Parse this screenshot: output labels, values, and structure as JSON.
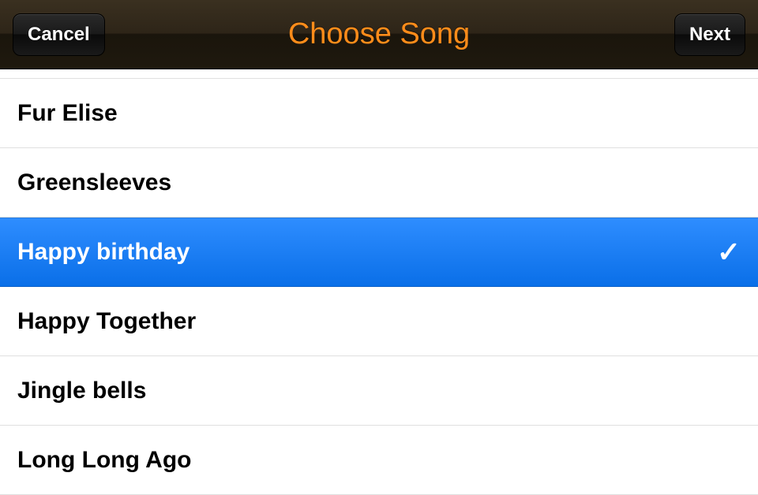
{
  "navbar": {
    "title": "Choose Song",
    "cancel_label": "Cancel",
    "next_label": "Next"
  },
  "songs": [
    {
      "label": "Fur Elise",
      "selected": false
    },
    {
      "label": "Greensleeves",
      "selected": false
    },
    {
      "label": "Happy birthday",
      "selected": true
    },
    {
      "label": "Happy Together",
      "selected": false
    },
    {
      "label": "Jingle bells",
      "selected": false
    },
    {
      "label": "Long Long Ago",
      "selected": false
    }
  ]
}
